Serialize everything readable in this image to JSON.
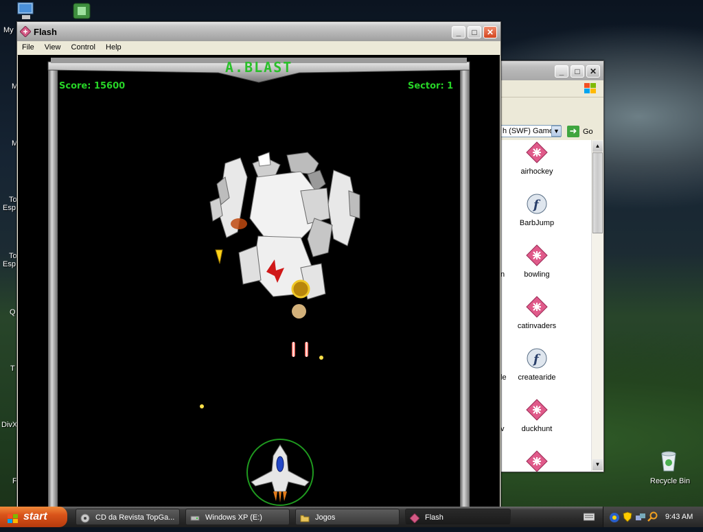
{
  "desktop": {
    "icon_labels": [
      "My",
      "M",
      "M",
      "To",
      "Esp",
      "To",
      "Esp",
      "Q",
      "T",
      "DivX",
      "F"
    ],
    "recycle_bin_label": "Recycle Bin"
  },
  "flash_window": {
    "title": "Flash",
    "menu": [
      "File",
      "View",
      "Control",
      "Help"
    ],
    "game": {
      "logo": "A.BLAST",
      "score_text": "Score: 15600",
      "sector_text": "Sector: 1"
    }
  },
  "explorer_window": {
    "address_text": "h (SWF) Games",
    "go_label": "Go",
    "files": [
      {
        "name": "airhockey",
        "icon": "swf-pink-icon"
      },
      {
        "name": "BarbJump",
        "icon": "flash-f-icon"
      },
      {
        "name": "bowling",
        "icon": "swf-pink-icon"
      },
      {
        "name": "catinvaders",
        "icon": "swf-pink-icon"
      },
      {
        "name": "createaride",
        "icon": "flash-f-icon"
      },
      {
        "name": "duckhunt",
        "icon": "swf-pink-icon"
      },
      {
        "name": "",
        "icon": "swf-pink-icon"
      }
    ],
    "clipped_left_letters": [
      "n",
      "le",
      "v"
    ]
  },
  "taskbar": {
    "start_label": "start",
    "tasks": [
      {
        "label": "CD da Revista TopGa...",
        "icon": "cd-icon"
      },
      {
        "label": "Windows XP (E:)",
        "icon": "drive-icon"
      },
      {
        "label": "Jogos",
        "icon": "folder-icon"
      },
      {
        "label": "Flash",
        "icon": "flash-app-icon"
      }
    ],
    "clock": "9:43 AM"
  },
  "colors": {
    "hud_green": "#27d427",
    "start_orange": "#d9541a",
    "close_red": "#d3451f"
  }
}
